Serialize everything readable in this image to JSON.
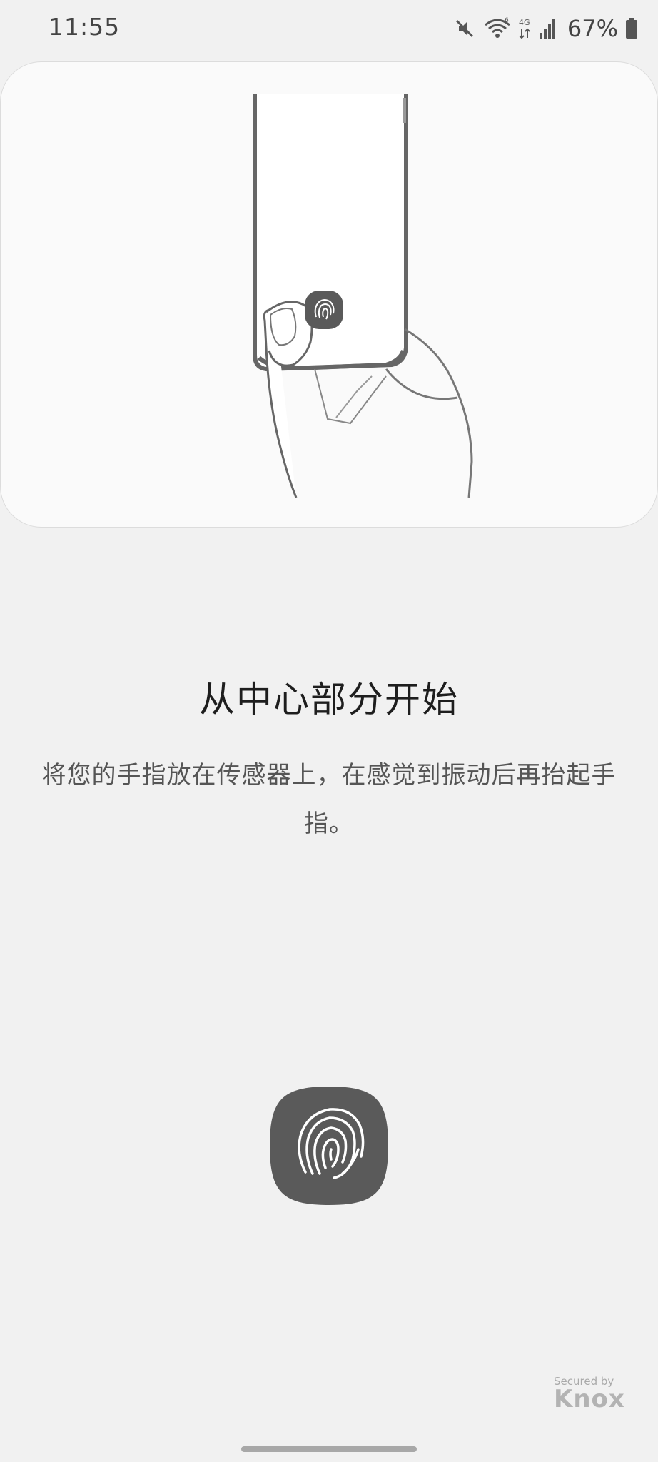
{
  "status_bar": {
    "time": "11:55",
    "battery_percent": "67%",
    "icons": [
      "mute-icon",
      "wifi-icon",
      "4g-signal-icon",
      "signal-bars-icon",
      "battery-icon"
    ]
  },
  "illustration": {
    "icon": "hand-holding-phone-illustration"
  },
  "title": "从中心部分开始",
  "description": "将您的手指放在传感器上，在感觉到振动后再抬起手指。",
  "sensor": {
    "icon": "fingerprint-icon"
  },
  "knox": {
    "secured_by": "Secured by",
    "brand": "Knox"
  },
  "colors": {
    "background": "#f1f1f1",
    "card": "#fafafa",
    "sensor": "#5a5a5a"
  }
}
